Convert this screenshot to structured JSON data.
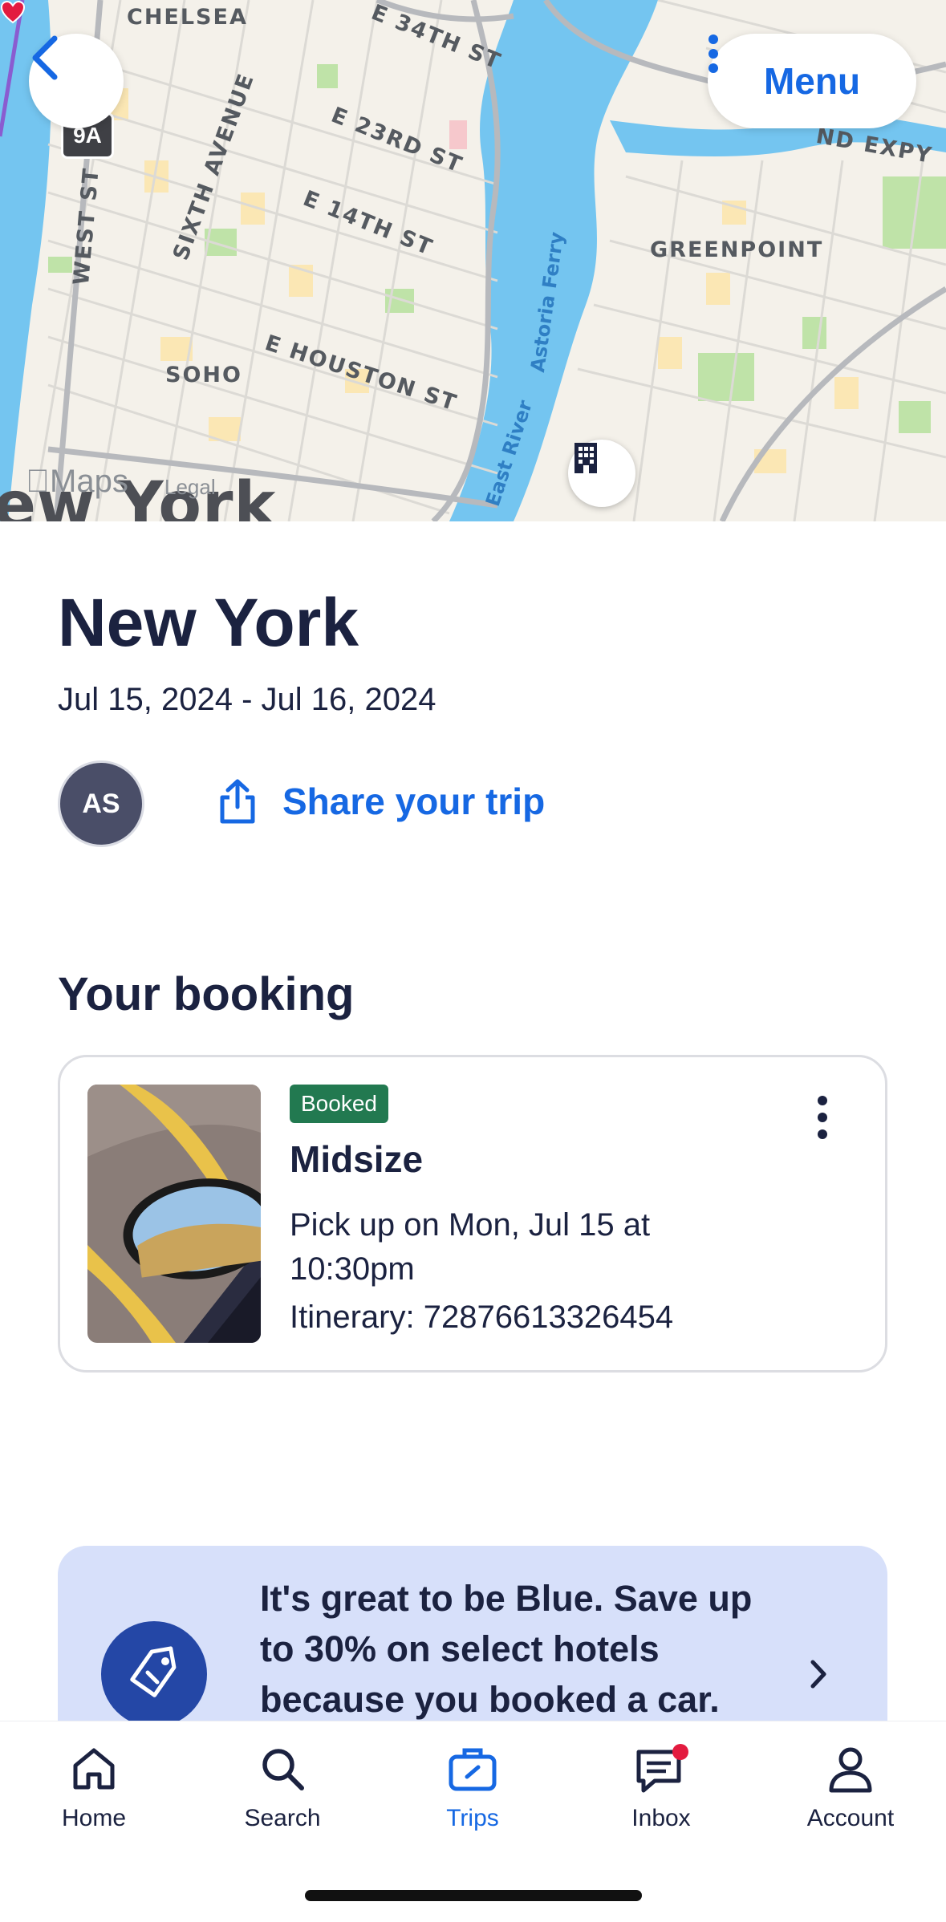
{
  "map": {
    "labels": {
      "chelsea": "CHELSEA",
      "st34": "E 34TH ST",
      "st23": "E 23RD ST",
      "st14": "E 14TH ST",
      "houston": "E HOUSTON ST",
      "sixth": "SIXTH AVENUE",
      "westst": "WEST ST",
      "soho": "SOHO",
      "greenpoint": "GREENPOINT",
      "expy": "ND EXPY",
      "ferry": "Astoria Ferry",
      "eastriver": "East River",
      "route": "9A",
      "city_partial": "ew York"
    },
    "attribution": "Maps",
    "legal": "Legal"
  },
  "nav": {
    "back_icon": "chevron-left-icon",
    "menu_label": "Menu"
  },
  "trip": {
    "title": "New York",
    "dates": "Jul 15, 2024 - Jul 16, 2024",
    "avatar_initials": "AS",
    "share_label": "Share your trip"
  },
  "booking": {
    "section_title": "Your booking",
    "status": "Booked",
    "title": "Midsize",
    "pickup": "Pick up on Mon, Jul 15 at 10:30pm",
    "itinerary": "Itinerary: 72876613326454"
  },
  "promo": {
    "text": "It's great to be Blue. Save up to 30% on select hotels because you booked a car."
  },
  "tabs": [
    {
      "label": "Home",
      "icon": "home-icon"
    },
    {
      "label": "Search",
      "icon": "search-icon"
    },
    {
      "label": "Trips",
      "icon": "briefcase-icon"
    },
    {
      "label": "Inbox",
      "icon": "chat-icon"
    },
    {
      "label": "Account",
      "icon": "person-icon"
    }
  ],
  "colors": {
    "brand_blue": "#1668e3",
    "navy": "#1b2240",
    "booked_green": "#227950",
    "promo_bg": "#d7e0fa",
    "notification_red": "#e31b3f"
  }
}
